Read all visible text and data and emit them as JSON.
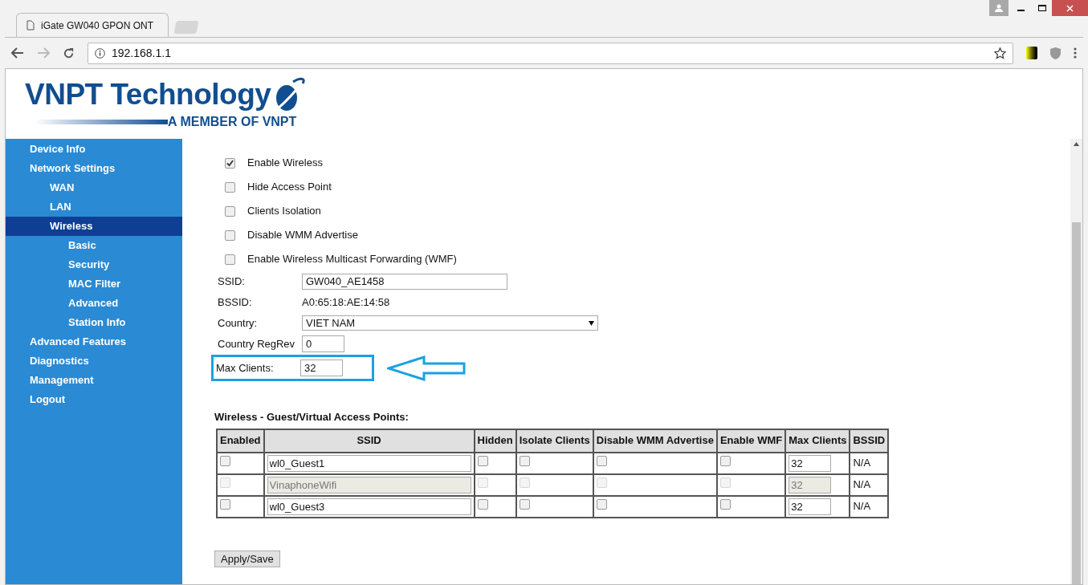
{
  "browser": {
    "tab_title": "iGate GW040 GPON ONT",
    "address": "192.168.1.1"
  },
  "header": {
    "logo_title": "VNPT Technology",
    "logo_subtitle": "A MEMBER OF VNPT"
  },
  "sidebar": {
    "items": [
      {
        "label": "Device Info",
        "selected": false
      },
      {
        "label": "Network Settings",
        "selected": false,
        "children": [
          {
            "label": "WAN",
            "selected": false
          },
          {
            "label": "LAN",
            "selected": false
          },
          {
            "label": "Wireless",
            "selected": true,
            "children": [
              {
                "label": "Basic",
                "selected": false
              },
              {
                "label": "Security",
                "selected": false
              },
              {
                "label": "MAC Filter",
                "selected": false
              },
              {
                "label": "Advanced",
                "selected": false
              },
              {
                "label": "Station Info",
                "selected": false
              }
            ]
          }
        ]
      },
      {
        "label": "Advanced Features",
        "selected": false
      },
      {
        "label": "Diagnostics",
        "selected": false
      },
      {
        "label": "Management",
        "selected": false
      },
      {
        "label": "Logout",
        "selected": false
      }
    ]
  },
  "options": [
    {
      "label": "Enable Wireless",
      "checked": true
    },
    {
      "label": "Hide Access Point",
      "checked": false
    },
    {
      "label": "Clients Isolation",
      "checked": false
    },
    {
      "label": "Disable WMM Advertise",
      "checked": false
    },
    {
      "label": "Enable Wireless Multicast Forwarding (WMF)",
      "checked": false
    }
  ],
  "fields": [
    {
      "kind": "input",
      "label": "SSID:",
      "value": "GW040_AE1458",
      "highlighted": false
    },
    {
      "kind": "text",
      "label": "BSSID:",
      "value": "A0:65:18:AE:14:58",
      "highlighted": false
    },
    {
      "kind": "select",
      "label": "Country:",
      "value": "VIET NAM",
      "highlighted": false
    },
    {
      "kind": "short",
      "label": "Country RegRev",
      "value": "0",
      "highlighted": false
    },
    {
      "kind": "short",
      "label": "Max Clients:",
      "value": "32",
      "highlighted": true
    }
  ],
  "guest_table": {
    "title": "Wireless - Guest/Virtual Access Points:",
    "columns": [
      "Enabled",
      "SSID",
      "Hidden",
      "Isolate Clients",
      "Disable WMM Advertise",
      "Enable WMF",
      "Max Clients",
      "BSSID"
    ],
    "rows": [
      {
        "disabled": false,
        "enabled": false,
        "ssid": "wl0_Guest1",
        "hidden": false,
        "isolate_clients": false,
        "disable_wmm": false,
        "enable_wmf": false,
        "max_clients": "32",
        "bssid": "N/A"
      },
      {
        "disabled": true,
        "enabled": false,
        "ssid": "VinaphoneWifi",
        "hidden": false,
        "isolate_clients": false,
        "disable_wmm": false,
        "enable_wmf": false,
        "max_clients": "32",
        "bssid": "N/A"
      },
      {
        "disabled": false,
        "enabled": false,
        "ssid": "wl0_Guest3",
        "hidden": false,
        "isolate_clients": false,
        "disable_wmm": false,
        "enable_wmf": false,
        "max_clients": "32",
        "bssid": "N/A"
      }
    ]
  },
  "save_button": "Apply/Save"
}
